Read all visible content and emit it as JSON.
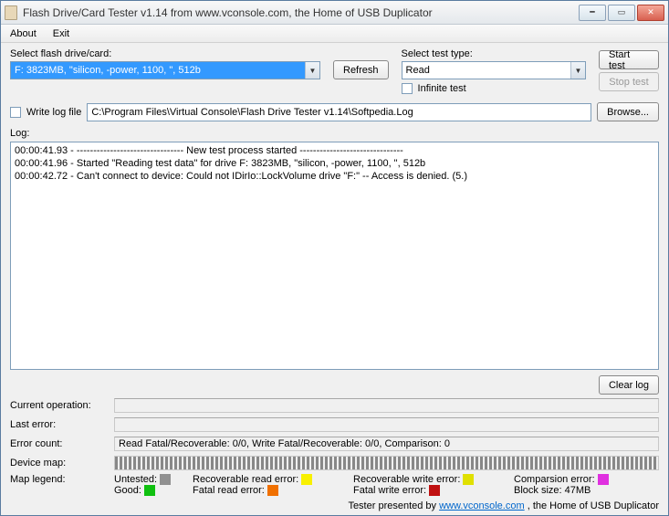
{
  "window": {
    "title": "Flash Drive/Card Tester v1.14 from www.vconsole.com, the Home of USB Duplicator"
  },
  "menu": {
    "about": "About",
    "exit": "Exit"
  },
  "drive": {
    "label": "Select flash drive/card:",
    "selected": "F: 3823MB, \"silicon, -power, 1100, \", 512b",
    "refresh": "Refresh"
  },
  "test": {
    "label": "Select test type:",
    "selected": "Read",
    "infinite_label": "Infinite test",
    "start": "Start test",
    "stop": "Stop test"
  },
  "logfile": {
    "write_label": "Write log file",
    "path": "C:\\Program Files\\Virtual Console\\Flash Drive Tester v1.14\\Softpedia.Log",
    "browse": "Browse..."
  },
  "log": {
    "label": "Log:",
    "lines": "00:00:41.93 - -------------------------------- New test process started -------------------------------\n00:00:41.96 - Started \"Reading test data\" for drive F: 3823MB, \"silicon, -power, 1100, \", 512b\n00:00:42.72 - Can't connect to device: Could not IDirIo::LockVolume drive \"F:\" -- Access is denied. (5.)",
    "clear": "Clear log"
  },
  "status": {
    "current_op_label": "Current operation:",
    "current_op_value": "",
    "last_error_label": "Last error:",
    "last_error_value": "",
    "error_count_label": "Error count:",
    "error_count_value": "Read Fatal/Recoverable: 0/0, Write Fatal/Recoverable: 0/0, Comparison: 0",
    "device_map_label": "Device map:",
    "legend_label": "Map legend:"
  },
  "legend": {
    "untested": "Untested:",
    "good": "Good:",
    "rec_read": "Recoverable read error:",
    "fatal_read": "Fatal read error:",
    "rec_write": "Recoverable write error:",
    "fatal_write": "Fatal write error:",
    "comparison": "Comparsion error:",
    "block_size_label": "Block size:",
    "block_size_value": "47MB",
    "colors": {
      "untested": "#909090",
      "good": "#10c010",
      "rec_read": "#f8f000",
      "fatal_read": "#f07000",
      "rec_write": "#e0e000",
      "fatal_write": "#c01010",
      "comparison": "#e030e0"
    }
  },
  "footer": {
    "prefix": "Tester presented by ",
    "link": "www.vconsole.com",
    "suffix": " , the Home of USB Duplicator"
  }
}
